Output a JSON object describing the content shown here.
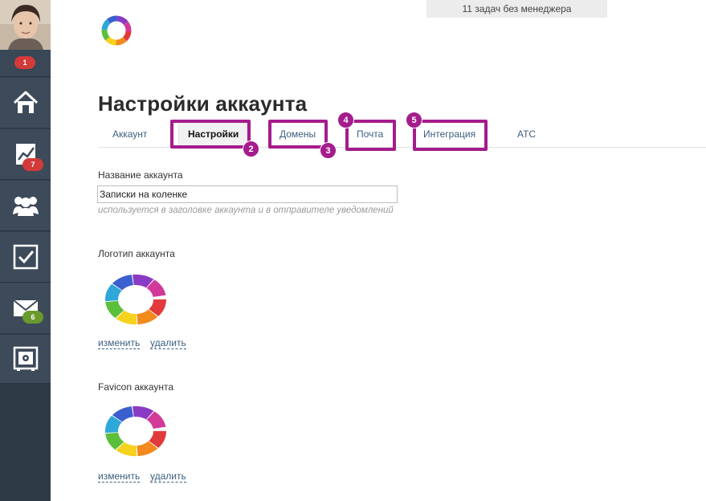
{
  "sidebar": {
    "avatar_badge": "1",
    "items": [
      {
        "name": "home",
        "icon": "home-icon",
        "badge": ""
      },
      {
        "name": "analytics",
        "icon": "chart-icon",
        "badge": "7"
      },
      {
        "name": "contacts",
        "icon": "users-icon",
        "badge": ""
      },
      {
        "name": "tasks",
        "icon": "checkbox-icon",
        "badge": ""
      },
      {
        "name": "mail",
        "icon": "mail-icon",
        "badge": "6"
      },
      {
        "name": "settings",
        "icon": "safe-icon",
        "badge": ""
      }
    ]
  },
  "top_banner": "11 задач без менеджера",
  "page_title": "Настройки аккаунта",
  "tabs": [
    {
      "label": "Аккаунт",
      "active": false
    },
    {
      "label": "Настройки",
      "active": true
    },
    {
      "label": "Домены",
      "active": false
    },
    {
      "label": "Почта",
      "active": false
    },
    {
      "label": "Интеграция",
      "active": false
    },
    {
      "label": "АТС",
      "active": false
    }
  ],
  "callouts": [
    "2",
    "3",
    "4",
    "5"
  ],
  "account_name": {
    "label": "Название аккаунта",
    "value": "Записки на коленке",
    "hint": "используется в заголовке аккаунта и в отправителе уведомлений"
  },
  "account_logo": {
    "label": "Логотип аккаунта",
    "change": "изменить",
    "delete": "удалить"
  },
  "account_favicon": {
    "label": "Favicon аккаунта",
    "change": "изменить",
    "delete": "удалить"
  },
  "colors": {
    "sidebar": "#34404e",
    "highlight": "#a51c8c",
    "link": "#3b5f7f",
    "badge_red": "#d33a3a",
    "badge_green": "#6a9a2e"
  }
}
